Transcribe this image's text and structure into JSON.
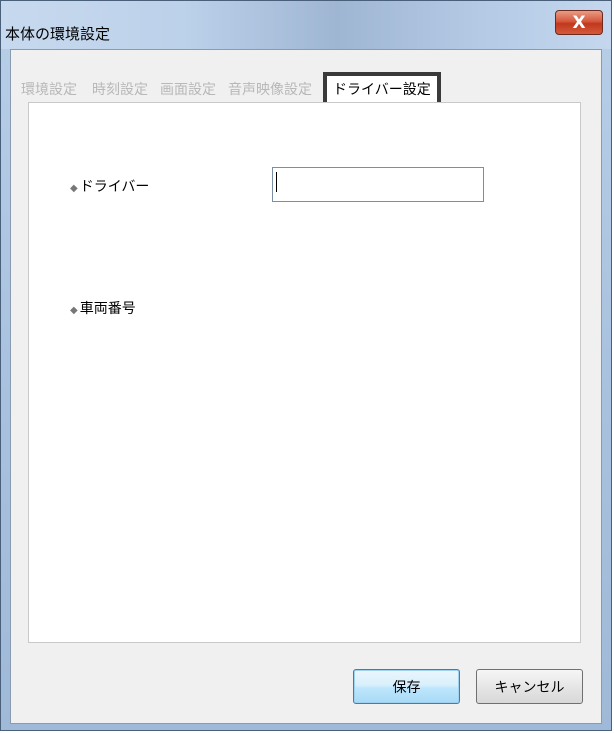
{
  "window": {
    "title": "本体の環境設定",
    "close_label": "X"
  },
  "tabs": [
    {
      "label": "環境設定",
      "active": false
    },
    {
      "label": "時刻設定",
      "active": false
    },
    {
      "label": "画面設定",
      "active": false
    },
    {
      "label": "音声映像設定",
      "active": false
    },
    {
      "label": "ドライバー設定",
      "active": true
    }
  ],
  "form": {
    "driver": {
      "label": "ドライバー",
      "value": ""
    },
    "vehicle_number": {
      "label": "車両番号",
      "value": ""
    }
  },
  "buttons": {
    "save_label": "保存",
    "cancel_label": "キャンセル"
  }
}
